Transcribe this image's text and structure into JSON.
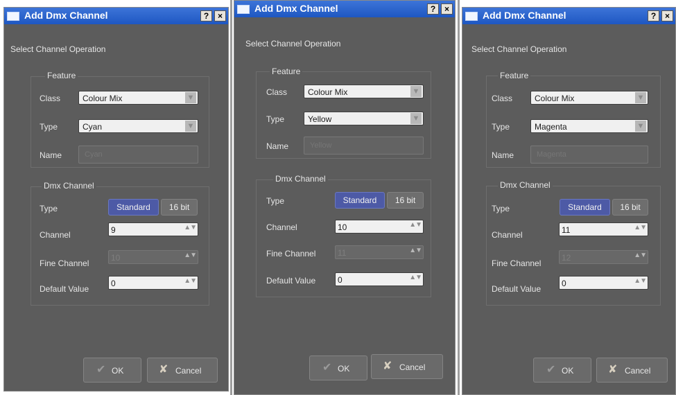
{
  "dialogs": [
    {
      "title": "Add Dmx Channel",
      "help_label": "?",
      "close_label": "×",
      "operation_label": "Select Channel Operation",
      "feature_legend": "Feature",
      "class_label": "Class",
      "class_value": "Colour Mix",
      "type_label": "Type",
      "type_value": "Cyan",
      "name_label": "Name",
      "name_placeholder": "Cyan",
      "dmx_legend": "Dmx Channel",
      "dmx_type_label": "Type",
      "standard_label": "Standard",
      "bit16_label": "16 bit",
      "channel_label": "Channel",
      "channel_value": "9",
      "fine_label": "Fine Channel",
      "fine_value": "10",
      "default_label": "Default Value",
      "default_value": "0",
      "ok_label": "OK",
      "cancel_label": "Cancel"
    },
    {
      "title": "Add Dmx Channel",
      "help_label": "?",
      "close_label": "×",
      "operation_label": "Select Channel Operation",
      "feature_legend": "Feature",
      "class_label": "Class",
      "class_value": "Colour Mix",
      "type_label": "Type",
      "type_value": "Yellow",
      "name_label": "Name",
      "name_placeholder": "Yellow",
      "dmx_legend": "Dmx Channel",
      "dmx_type_label": "Type",
      "standard_label": "Standard",
      "bit16_label": "16 bit",
      "channel_label": "Channel",
      "channel_value": "10",
      "fine_label": "Fine Channel",
      "fine_value": "11",
      "default_label": "Default Value",
      "default_value": "0",
      "ok_label": "OK",
      "cancel_label": "Cancel"
    },
    {
      "title": "Add Dmx Channel",
      "help_label": "?",
      "close_label": "×",
      "operation_label": "Select Channel Operation",
      "feature_legend": "Feature",
      "class_label": "Class",
      "class_value": "Colour Mix",
      "type_label": "Type",
      "type_value": "Magenta",
      "name_label": "Name",
      "name_placeholder": "Magenta",
      "dmx_legend": "Dmx Channel",
      "dmx_type_label": "Type",
      "standard_label": "Standard",
      "bit16_label": "16 bit",
      "channel_label": "Channel",
      "channel_value": "11",
      "fine_label": "Fine Channel",
      "fine_value": "12",
      "default_label": "Default Value",
      "default_value": "0",
      "ok_label": "OK",
      "cancel_label": "Cancel"
    }
  ],
  "icons": {
    "dropdown": "▼",
    "spin": "▲▼",
    "ok": "✔",
    "cancel": "✘"
  },
  "colors": {
    "titlebar": "#2a63cc",
    "panel": "#5c5c5c",
    "selected_toggle": "#4d5aa6"
  }
}
